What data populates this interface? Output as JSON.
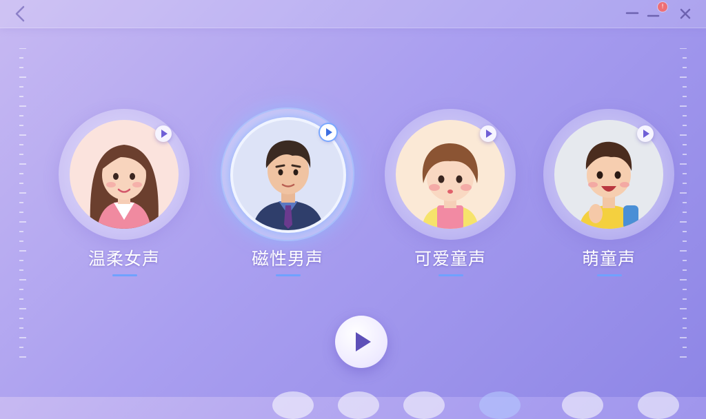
{
  "window": {
    "back_icon": "chevron-left-icon",
    "minimize_icon": "minimize-icon",
    "notification_icon": "minimize-notification-icon",
    "notification_badge": "!",
    "close_icon": "close-icon"
  },
  "voices": [
    {
      "label": "温柔女声",
      "icon": "play-icon",
      "avatar": "gentle-female-avatar",
      "selected": false
    },
    {
      "label": "磁性男声",
      "icon": "play-icon",
      "avatar": "magnetic-male-avatar",
      "selected": true
    },
    {
      "label": "可爱童声",
      "icon": "play-icon",
      "avatar": "cute-child-girl-avatar",
      "selected": false
    },
    {
      "label": "萌童声",
      "icon": "play-icon",
      "avatar": "cute-child-boy-avatar",
      "selected": false
    }
  ],
  "player": {
    "play_icon": "play-icon"
  },
  "colors": {
    "background_start": "#c7b9f2",
    "background_end": "#8e86e6",
    "accent": "#6fa2ff",
    "play_triangle": "#5e50b8"
  }
}
